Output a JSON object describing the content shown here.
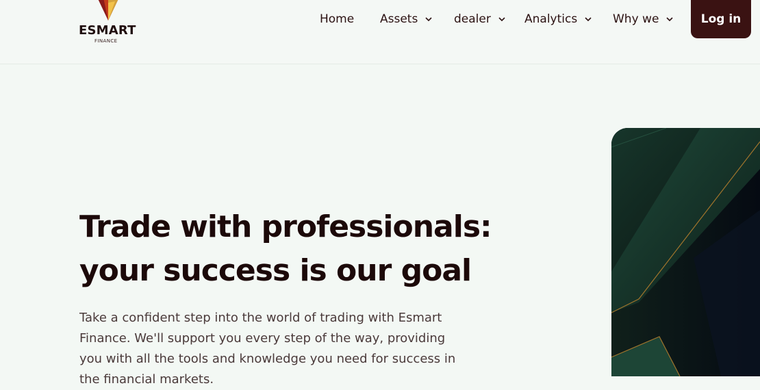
{
  "brand": {
    "name": "ESMART",
    "subtitle": "FINANCE"
  },
  "nav": {
    "items": [
      {
        "label": "Home",
        "has_dropdown": false
      },
      {
        "label": "Assets",
        "has_dropdown": true
      },
      {
        "label": "dealer",
        "has_dropdown": true
      },
      {
        "label": "Analytics",
        "has_dropdown": true
      },
      {
        "label": "Why we",
        "has_dropdown": true
      }
    ],
    "login_label": "Log in"
  },
  "hero": {
    "title_line1": "Trade with professionals:",
    "title_line2": "your success is our goal",
    "description": "Take a confident step into the world of trading with Esmart Finance. We'll support you every step of the way, providing you with all the tools and knowledge you need for success in the financial markets."
  },
  "colors": {
    "background": "#f3f8f4",
    "accent": "#3a1212",
    "text": "#1c0909",
    "image_green": "#1a3a2e",
    "image_gold": "#b88a3a"
  },
  "icons": {
    "logo": "diamond-gem-icon",
    "dropdown": "chevron-down-icon"
  }
}
